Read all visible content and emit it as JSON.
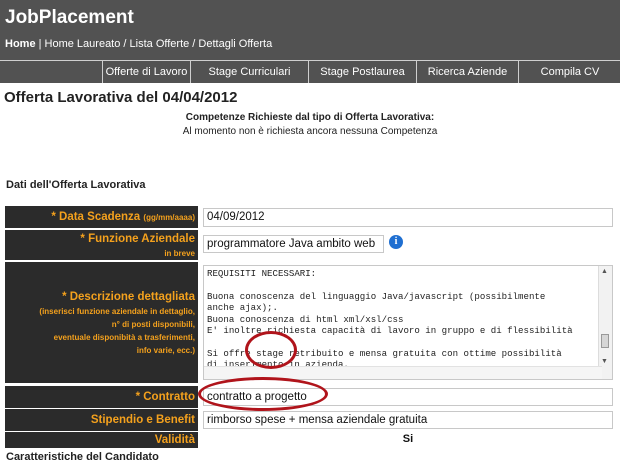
{
  "app": {
    "title": "JobPlacement"
  },
  "breadcrumb": {
    "home": "Home",
    "rest": " | Home Laureato / Lista Offerte / Dettagli Offerta"
  },
  "nav": [
    "Offerte di Lavoro",
    "Stage Curriculari",
    "Stage Postlaurea",
    "Ricerca Aziende",
    "Compila CV"
  ],
  "page": {
    "title": "Offerta Lavorativa del 04/04/2012",
    "competenze_heading": "Competenze Richieste dal tipo di Offerta Lavorativa:",
    "competenze_note": "Al momento non è richiesta ancora nessuna Competenza",
    "section_title": "Dati dell'Offerta Lavorativa",
    "candidate_title": "Caratteristiche del Candidato"
  },
  "fields": {
    "data_scadenza": {
      "label": "* Data Scadenza",
      "sub": "(gg/mm/aaaa)",
      "value": "04/09/2012"
    },
    "funzione": {
      "label": "* Funzione Aziendale",
      "sub": "in breve",
      "value": "programmatore Java ambito web"
    },
    "descrizione": {
      "label": "* Descrizione dettagliata",
      "sub1": "(inserisci funzione aziendale in dettaglio,",
      "sub2": "n° di posti disponibili,",
      "sub3": "eventuale disponibità a trasferimenti,",
      "sub4": "info varie, ecc.)",
      "text": "REQUISITI NECESSARI:\n\nBuona conoscenza del linguaggio Java/javascript (possibilmente\nanche ajax);.\nBuona conoscenza di html xml/xsl/css\nE' inoltre richiesta capacità di lavoro in gruppo e di flessibilità\n\nSi offre stage retribuito e mensa gratuita con ottime possibilità\ndi inserimento in azienda."
    },
    "contratto": {
      "label": "* Contratto",
      "value": "contratto a progetto"
    },
    "stipendio": {
      "label": "Stipendio e Benefit",
      "value": "rimborso spese + mensa aziendale gratuita"
    },
    "validita": {
      "label": "Validità",
      "value": "Si"
    }
  },
  "icons": {
    "info": "info-icon"
  },
  "colors": {
    "header": "#525252",
    "label_bg": "#2b2b2b",
    "label_text": "#f4a11d",
    "annotation": "#b0141b",
    "info_icon": "#1f6fd1"
  }
}
